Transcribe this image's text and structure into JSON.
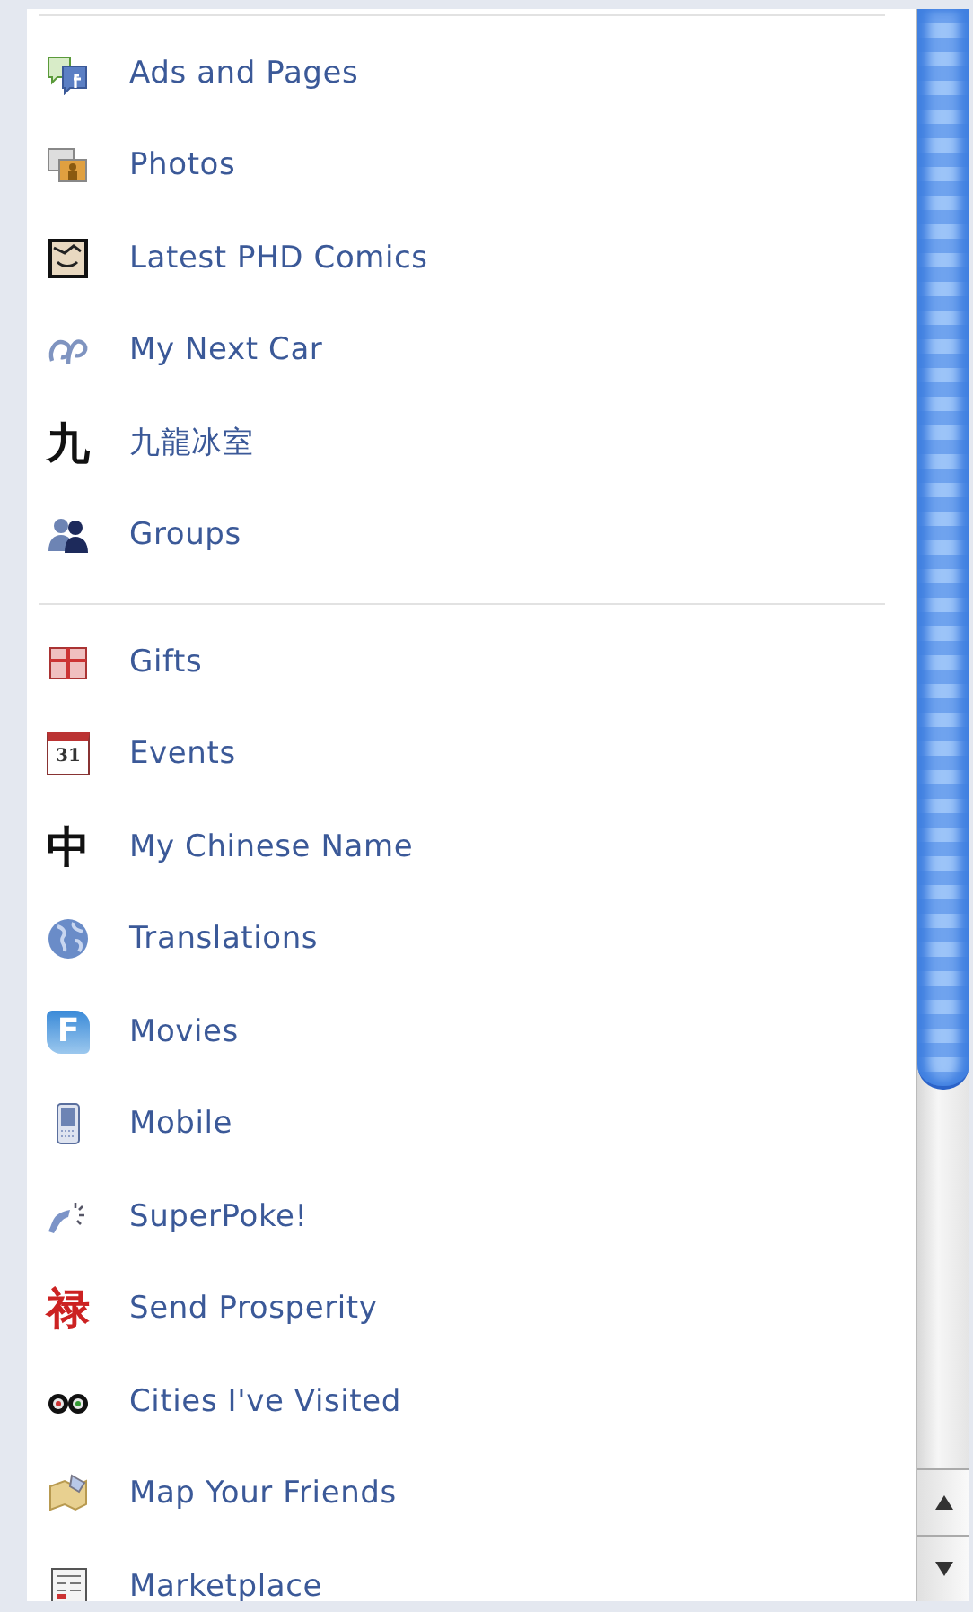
{
  "groups": [
    {
      "items": [
        {
          "label": "Ads and Pages"
        },
        {
          "label": "Photos"
        },
        {
          "label": "Latest PHD Comics"
        },
        {
          "label": "My Next Car"
        },
        {
          "label": "九龍冰室",
          "glyph": "九"
        },
        {
          "label": "Groups"
        }
      ]
    },
    {
      "items": [
        {
          "label": "Gifts"
        },
        {
          "label": "Events",
          "glyph": "31"
        },
        {
          "label": "My Chinese Name",
          "glyph": "中"
        },
        {
          "label": "Translations"
        },
        {
          "label": "Movies",
          "glyph": "F"
        },
        {
          "label": "Mobile"
        },
        {
          "label": "SuperPoke!"
        },
        {
          "label": "Send Prosperity",
          "glyph": "禄"
        },
        {
          "label": "Cities I've Visited"
        },
        {
          "label": "Map Your Friends"
        },
        {
          "label": "Marketplace"
        }
      ]
    }
  ]
}
